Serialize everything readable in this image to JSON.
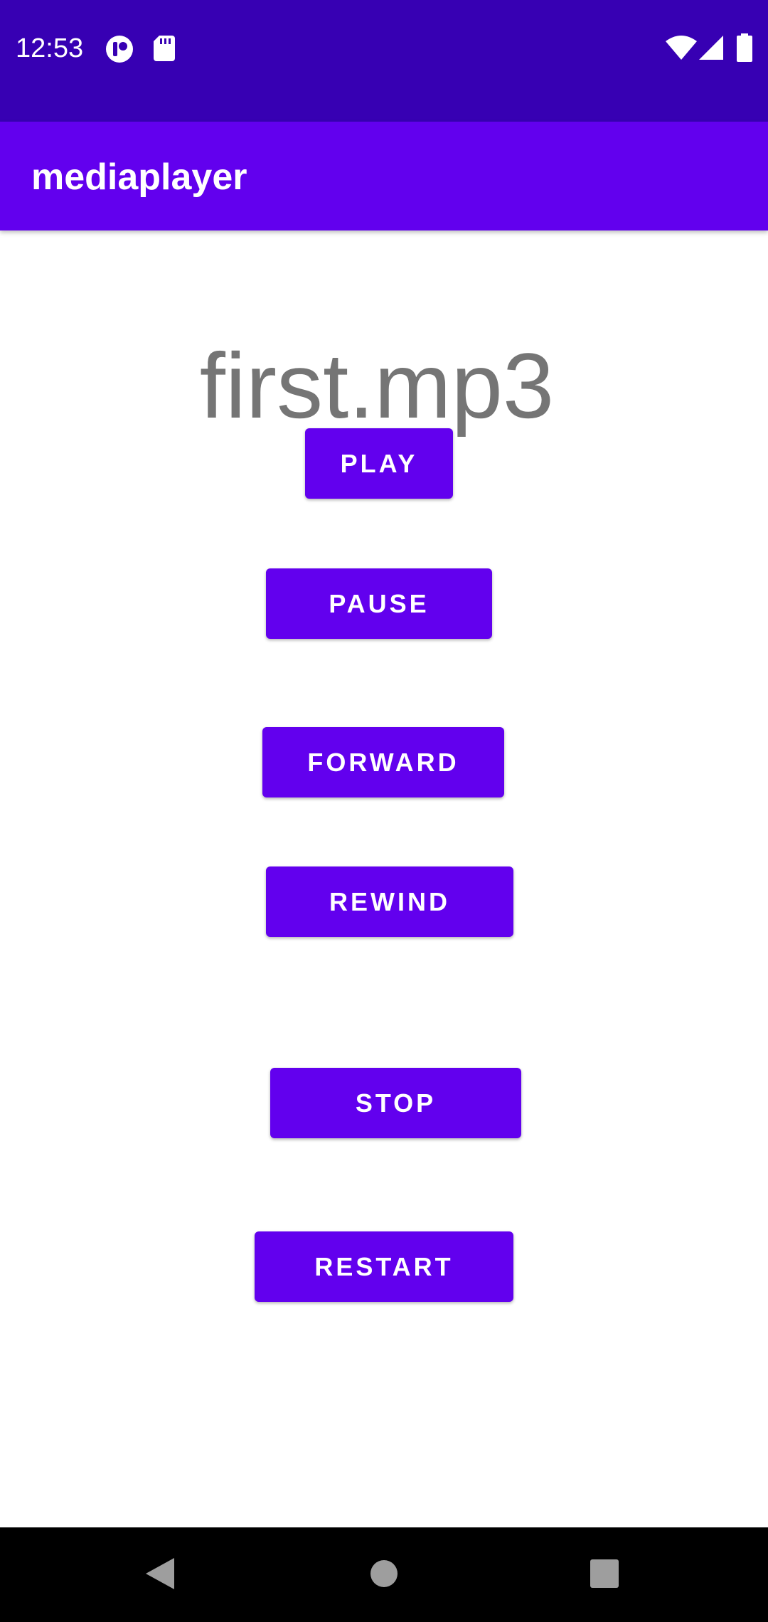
{
  "status_bar": {
    "time": "12:53",
    "background_color": "#3700B3",
    "left_icons": [
      "notification-app-icon",
      "sd-card-icon"
    ],
    "right_icons": [
      "wifi-icon",
      "cellular-signal-icon",
      "battery-icon"
    ]
  },
  "app_bar": {
    "title": "mediaplayer",
    "background_color": "#6200EE"
  },
  "player": {
    "track_name": "first.mp3",
    "buttons": {
      "play": "PLAY",
      "pause": "PAUSE",
      "forward": "FORWARD",
      "rewind": "REWIND",
      "stop": "STOP",
      "restart": "RESTART"
    },
    "button_color": "#6200EE"
  },
  "nav_bar": {
    "icons": [
      "back-icon",
      "home-icon",
      "recents-icon"
    ]
  }
}
